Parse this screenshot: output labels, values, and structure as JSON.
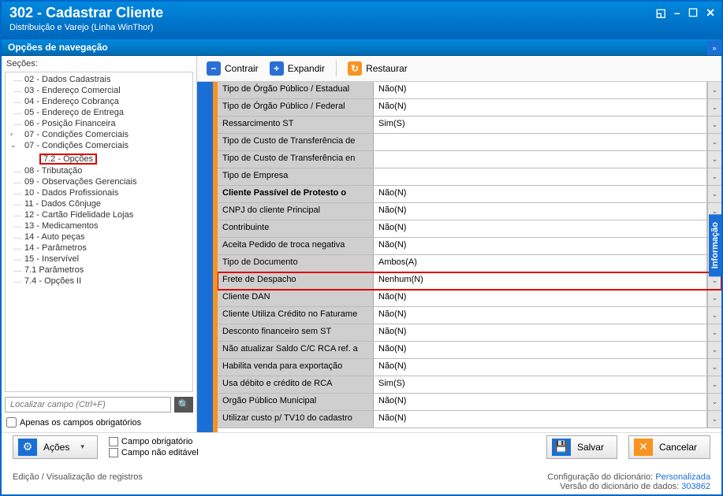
{
  "window": {
    "title": "302 - Cadastrar Cliente",
    "subtitle": "Distribuição e Varejo (Linha WinThor)"
  },
  "nav_header": "Opções de navegação",
  "sections_label": "Seções:",
  "tree": [
    {
      "label": "02 - Dados Cadastrais",
      "level": 1
    },
    {
      "label": "03 - Endereço Comercial",
      "level": 1
    },
    {
      "label": "04 - Endereço Cobrança",
      "level": 1
    },
    {
      "label": "05 - Endereço de Entrega",
      "level": 1
    },
    {
      "label": "06 - Posição Financeira",
      "level": 1
    },
    {
      "label": "07 - Condições Comerciais",
      "level": 1,
      "expander": ">"
    },
    {
      "label": "07 - Condições Comerciais",
      "level": 1,
      "expander": "v"
    },
    {
      "label": "7.2 - Opções",
      "level": 2,
      "highlight": true
    },
    {
      "label": "08 - Tributação",
      "level": 1
    },
    {
      "label": "09 - Observações Gerenciais",
      "level": 1
    },
    {
      "label": "10 - Dados Profissionais",
      "level": 1
    },
    {
      "label": "11 - Dados Cônjuge",
      "level": 1
    },
    {
      "label": "12 - Cartão Fidelidade Lojas",
      "level": 1
    },
    {
      "label": "13 - Medicamentos",
      "level": 1
    },
    {
      "label": "14 - Auto peças",
      "level": 1
    },
    {
      "label": "14 - Parâmetros",
      "level": 1
    },
    {
      "label": "15 - Inservível",
      "level": 1
    },
    {
      "label": "7.1 Parâmetros",
      "level": 1
    },
    {
      "label": "7.4 - Opções II",
      "level": 1
    }
  ],
  "search_placeholder": "Localizar campo (Ctrl+F)",
  "chk_obrig": "Apenas os campos obrigatórios",
  "toolbar": {
    "contrair": "Contrair",
    "expandir": "Expandir",
    "restaurar": "Restaurar"
  },
  "rows": [
    {
      "label": "Tipo de Órgão Público / Estadual",
      "value": "Não(N)"
    },
    {
      "label": "Tipo de Órgão Público / Federal",
      "value": "Não(N)"
    },
    {
      "label": "Ressarcimento ST",
      "value": "Sim(S)"
    },
    {
      "label": "Tipo de Custo de Transferência de",
      "value": ""
    },
    {
      "label": "Tipo de Custo de Transferência en",
      "value": ""
    },
    {
      "label": "Tipo de Empresa",
      "value": ""
    },
    {
      "label": "Cliente Passível de Protesto o",
      "value": "Não(N)",
      "bold": true
    },
    {
      "label": "CNPJ do cliente Principal",
      "value": "Não(N)"
    },
    {
      "label": "Contribuinte",
      "value": "Não(N)"
    },
    {
      "label": "Aceita Pedido de troca negativa",
      "value": "Não(N)"
    },
    {
      "label": "Tipo de Documento",
      "value": "Ambos(A)"
    },
    {
      "label": "Frete de Despacho",
      "value": "Nenhum(N)",
      "highlight": true
    },
    {
      "label": "Cliente DAN",
      "value": "Não(N)"
    },
    {
      "label": "Cliente Utiliza Crédito no Faturame",
      "value": "Não(N)"
    },
    {
      "label": "Desconto financeiro sem ST",
      "value": "Não(N)"
    },
    {
      "label": "Não atualizar Saldo C/C RCA ref. a",
      "value": "Não(N)"
    },
    {
      "label": "Habilita venda para exportação",
      "value": "Não(N)"
    },
    {
      "label": "Usa débito e crédito de RCA",
      "value": "Sim(S)"
    },
    {
      "label": "Orgão Público Municipal",
      "value": "Não(N)"
    },
    {
      "label": "Utilizar custo p/ TV10 do cadastro",
      "value": "Não(N)"
    }
  ],
  "info_tab": "Informação",
  "footer": {
    "acoes": "Ações",
    "legend_obrig": "Campo obrigatório",
    "legend_noedit": "Campo não editável",
    "salvar": "Salvar",
    "cancelar": "Cancelar"
  },
  "status": {
    "left": "Edição / Visualização de registros",
    "cfg_label": "Configuração do dicionário:",
    "cfg_val": "Personalizada",
    "ver_label": "Versão do dicionário de dados:",
    "ver_val": "303862"
  }
}
